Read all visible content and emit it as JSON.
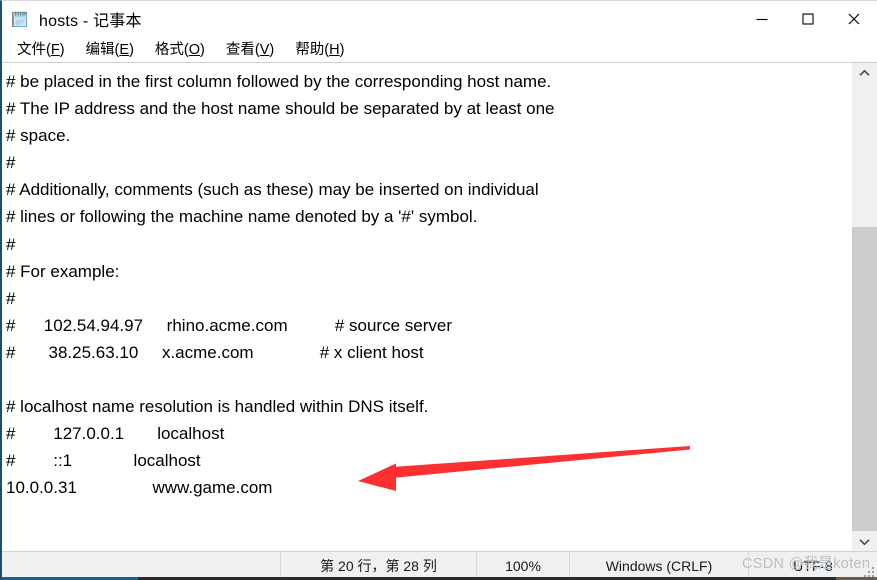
{
  "window": {
    "title": "hosts - 记事本",
    "icon": "notepad-icon",
    "controls": {
      "minimize": "—",
      "maximize": "□",
      "close": "✕"
    }
  },
  "menubar": {
    "items": [
      {
        "name": "file",
        "text": "文件",
        "accel": "F"
      },
      {
        "name": "edit",
        "text": "编辑",
        "accel": "E"
      },
      {
        "name": "format",
        "text": "格式",
        "accel": "O"
      },
      {
        "name": "view",
        "text": "查看",
        "accel": "V"
      },
      {
        "name": "help",
        "text": "帮助",
        "accel": "H"
      }
    ]
  },
  "editor": {
    "lines": [
      "# be placed in the first column followed by the corresponding host name.",
      "# The IP address and the host name should be separated by at least one",
      "# space.",
      "#",
      "# Additionally, comments (such as these) may be inserted on individual",
      "# lines or following the machine name denoted by a '#' symbol.",
      "#",
      "# For example:",
      "#",
      "#      102.54.94.97     rhino.acme.com          # source server",
      "#       38.25.63.10     x.acme.com              # x client host",
      "",
      "# localhost name resolution is handled within DNS itself.",
      "#        127.0.0.1       localhost",
      "#        ::1             localhost",
      "10.0.0.31                www.game.com"
    ]
  },
  "scrollbar": {
    "up_arrow": "▲",
    "down_arrow": "▼"
  },
  "statusbar": {
    "position": "第 20 行，第 28 列",
    "zoom": "100%",
    "line_ending": "Windows (CRLF)",
    "encoding": "UTF-8"
  },
  "watermark": {
    "text": "CSDN @我是koten"
  },
  "annotation": {
    "arrow": {
      "color": "#fc3030",
      "points_to": "10.0.0.31                www.game.com"
    }
  },
  "colors": {
    "accent_border": "#1b4f72",
    "arrow_red": "#fc3030",
    "statusbar_bg": "#f0f0f0",
    "scroll_thumb": "#cdcdcd"
  }
}
